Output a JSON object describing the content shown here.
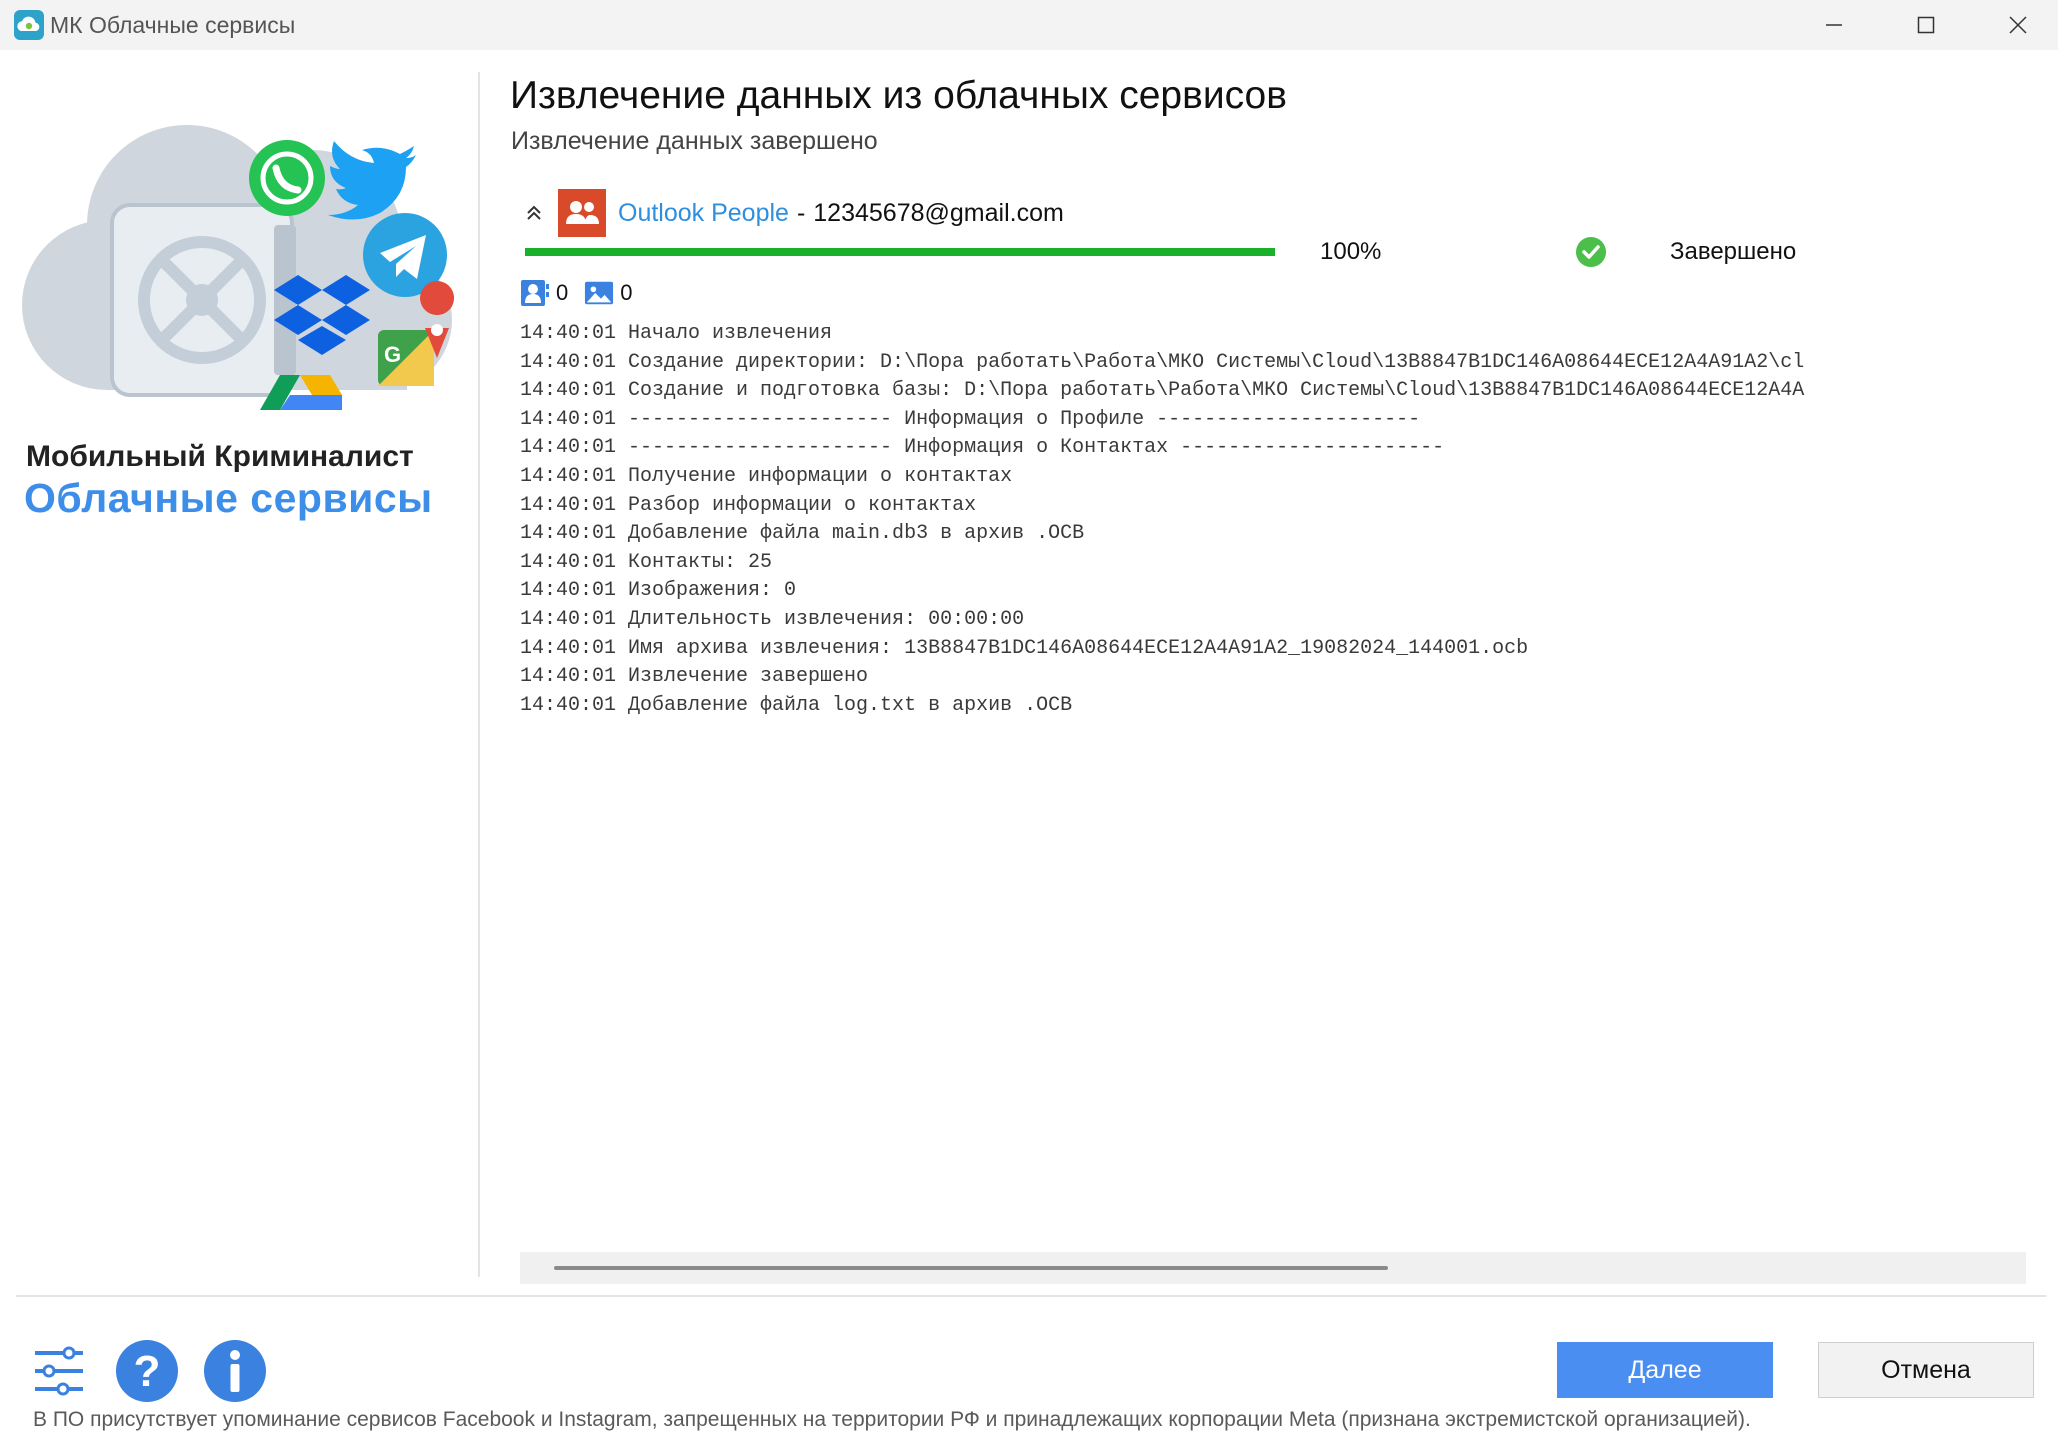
{
  "window": {
    "title": "МК Облачные сервисы"
  },
  "brand": {
    "line1": "Мобильный Криминалист",
    "line2": "Облачные сервисы"
  },
  "main": {
    "title": "Извлечение данных из облачных сервисов",
    "subtitle": "Извлечение данных завершено"
  },
  "task": {
    "service": "Outlook People",
    "separator": "-",
    "account": "12345678@gmail.com",
    "progress_percent": 100,
    "progress_label": "100%",
    "status": "Завершено",
    "contacts_count": "0",
    "images_count": "0"
  },
  "log": [
    "14:40:01 Начало извлечения",
    "14:40:01 Создание директории: D:\\Пора работать\\Работа\\МКО Системы\\Cloud\\13B8847B1DC146A08644ECE12A4A91A2\\cl",
    "14:40:01 Создание и подготовка базы: D:\\Пора работать\\Работа\\МКО Системы\\Cloud\\13B8847B1DC146A08644ECE12A4A",
    "14:40:01 ---------------------- Информация о Профиле ----------------------",
    "14:40:01 ---------------------- Информация о Контактах ----------------------",
    "14:40:01 Получение информации о контактах",
    "14:40:01 Разбор информации о контактах",
    "14:40:01 Добавление файла main.db3 в архив .OCB",
    "14:40:01 Контакты: 25",
    "14:40:01 Изображения: 0",
    "14:40:01 Длительность извлечения: 00:00:00",
    "14:40:01 Имя архива извлечения: 13B8847B1DC146A08644ECE12A4A91A2_19082024_144001.ocb",
    "14:40:01 Извлечение завершено",
    "14:40:01 Добавление файла log.txt в архив .OCB"
  ],
  "buttons": {
    "next": "Далее",
    "cancel": "Отмена"
  },
  "footer": {
    "icons": [
      "settings-icon",
      "help-icon",
      "info-icon"
    ],
    "disclaimer": "В ПО присутствует упоминание сервисов Facebook и Instagram, запрещенных на территории РФ и принадлежащих корпорации Meta (признана экстремистской организацией)."
  },
  "colors": {
    "accent": "#4a8ef2",
    "link": "#2d8fe0",
    "progress": "#19b12c",
    "service_icon": "#d94a2a",
    "brand_blue": "#3d8ee8"
  }
}
